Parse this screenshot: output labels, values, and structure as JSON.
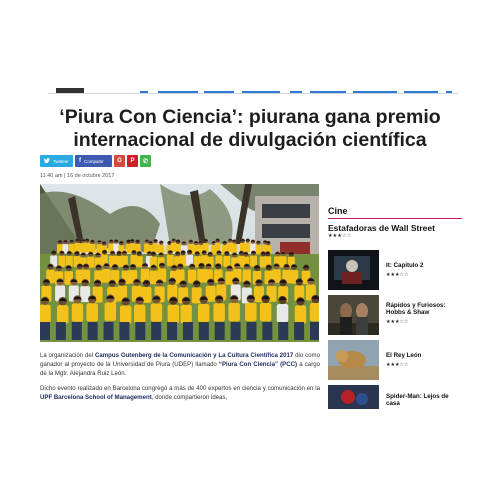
{
  "headline": "‘Piura Con Ciencia’: piurana gana premio internacional de divulgación científica",
  "share": {
    "twitter_label": "Twittear",
    "facebook_label": "Compartir",
    "twitter_icon": "twitter-bird",
    "facebook_icon": "facebook-f",
    "gplus_label": "G",
    "pinterest_label": "P",
    "whatsapp_label": "✆"
  },
  "dateline": "11:40 am | 16 de octubre 2017",
  "caption": {
    "p1_a": "La organización del ",
    "p1_b": "Campus Gutenberg de la Comunicación y La Cultura Científica 2017",
    "p1_c": " dio como ganador al proyecto de la Universidad de Piura (UDEP) llamado ",
    "p1_d": "“Piura Con Ciencia” (PCC)",
    "p1_e": " a cargo de la Mgtr. Alejandra Ruiz León.",
    "p2_a": "Dicho evento realizado en Barcelona congregó a más de 400 expertos en ciencia y comunicación en la ",
    "p2_b": "UPF Barcelona School of Management",
    "p2_c": ", donde compartieron ideas,"
  },
  "sidebar": {
    "section": "Cine",
    "feature_title": "Estafadoras de Wall Street",
    "feature_stars": "★★★☆☆",
    "movies": [
      {
        "title": "It: Capítulo 2",
        "stars": "★★★☆☆"
      },
      {
        "title": "Rápidos y Furiosos: Hobbs & Shaw",
        "stars": "★★★☆☆"
      },
      {
        "title": "El Rey León",
        "stars": "★★★☆☆"
      },
      {
        "title": "Spider-Man: Lejos de casa",
        "stars": ""
      }
    ]
  },
  "colors": {
    "accent": "#c2185b",
    "nav_blue": "#2e7bd6",
    "shirt_yellow": "#f2c21a"
  }
}
